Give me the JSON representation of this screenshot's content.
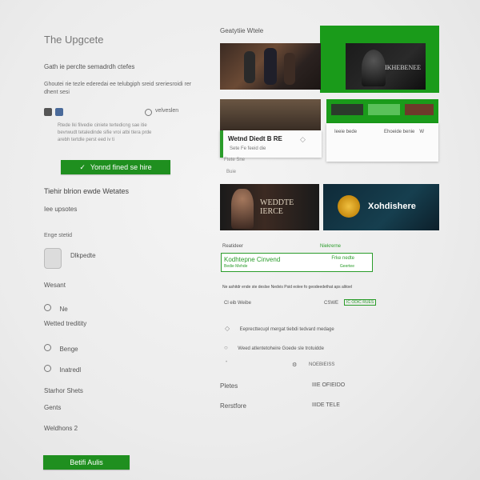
{
  "left": {
    "title": "The Upgcete",
    "subtitle": "Gath ie perclte semadrdh ctefes",
    "paragraph": "Ghoutei rie tezle ederedai ee telubgiph sreid sreriesroidi rer dhent sesi",
    "row_right_label": "velveslen",
    "desc_lines": [
      "Rtede Iki filvedie ciniete tertedicng sae itie",
      "bevrwudt tetaledinde sifie vroi atbi tlera prde",
      "arebh tertdle perst eed iv ti"
    ],
    "primary_button": "Yonnd fined se hire",
    "section_heading": "Tiehir blrion ewde Wetates",
    "section_sub": "Iee upsotes",
    "group_label": "Enge stetid",
    "profile_label": "Dlkpedte",
    "weanl": "Wesant",
    "radio_label": "Ne",
    "link_label": "Wetted treditity",
    "option1": "Benge",
    "option2": "Inatredl",
    "footer1": "Starhor Shets",
    "footer2": "Gents",
    "footer3": "Weldhons 2",
    "bottom_button": "Betifi Aulis"
  },
  "right": {
    "section_title": "Geatytiie Wtele",
    "thumb2_text": "IKHEBENEE",
    "card_label": "Wetnd Diedt B RE",
    "card_sub": "Sete Fe feeid die",
    "card_sub2": "Ftete Sne",
    "small_panel_a": "Ieeie bede",
    "small_panel_b": "Ehoeide benie",
    "small_panel_c": "W",
    "below_card": "Buie",
    "game1_title": "WEDDTE\nIERCE",
    "game2_title": "Xohdishere",
    "tab_left": "Reatideer",
    "tab_right": "Niekrerne",
    "input_value": "Kodhtepne Cinvend",
    "input_right": "Frke nedte",
    "input_sub": "Bedie Mehde",
    "input_sub_right": "Geertee",
    "notice": "Ne ashitdr ende ste deslse Nedvis Psid eolee fo geodeedethat aps alitoel",
    "row_left": "Cl eib Weibe",
    "row_right": "CSWE",
    "row_badge": "IC ODIC RUES",
    "list1": "Eeprecttecupl mergat tiebdi tedvard medage",
    "list2": "Weed atlentetoheire Goede sle trotuidde",
    "list3_right": "NOEBIEISS",
    "stat_l1": "Pletes",
    "stat_r1": "IIIE OFIEIDO",
    "stat_l2": "Rerstfore",
    "stat_r2": "IIIDE TELE"
  },
  "colors": {
    "green": "#1f8f1f",
    "green_bright": "#1a9b1a"
  }
}
